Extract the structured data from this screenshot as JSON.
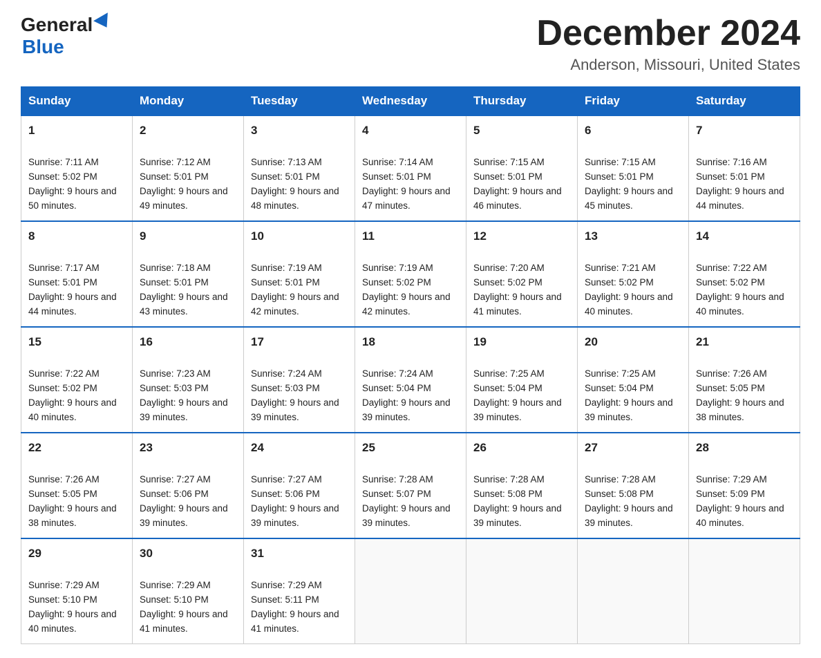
{
  "header": {
    "logo_general": "General",
    "logo_blue": "Blue",
    "month_title": "December 2024",
    "location": "Anderson, Missouri, United States"
  },
  "weekdays": [
    "Sunday",
    "Monday",
    "Tuesday",
    "Wednesday",
    "Thursday",
    "Friday",
    "Saturday"
  ],
  "weeks": [
    [
      {
        "day": "1",
        "sunrise": "Sunrise: 7:11 AM",
        "sunset": "Sunset: 5:02 PM",
        "daylight": "Daylight: 9 hours and 50 minutes."
      },
      {
        "day": "2",
        "sunrise": "Sunrise: 7:12 AM",
        "sunset": "Sunset: 5:01 PM",
        "daylight": "Daylight: 9 hours and 49 minutes."
      },
      {
        "day": "3",
        "sunrise": "Sunrise: 7:13 AM",
        "sunset": "Sunset: 5:01 PM",
        "daylight": "Daylight: 9 hours and 48 minutes."
      },
      {
        "day": "4",
        "sunrise": "Sunrise: 7:14 AM",
        "sunset": "Sunset: 5:01 PM",
        "daylight": "Daylight: 9 hours and 47 minutes."
      },
      {
        "day": "5",
        "sunrise": "Sunrise: 7:15 AM",
        "sunset": "Sunset: 5:01 PM",
        "daylight": "Daylight: 9 hours and 46 minutes."
      },
      {
        "day": "6",
        "sunrise": "Sunrise: 7:15 AM",
        "sunset": "Sunset: 5:01 PM",
        "daylight": "Daylight: 9 hours and 45 minutes."
      },
      {
        "day": "7",
        "sunrise": "Sunrise: 7:16 AM",
        "sunset": "Sunset: 5:01 PM",
        "daylight": "Daylight: 9 hours and 44 minutes."
      }
    ],
    [
      {
        "day": "8",
        "sunrise": "Sunrise: 7:17 AM",
        "sunset": "Sunset: 5:01 PM",
        "daylight": "Daylight: 9 hours and 44 minutes."
      },
      {
        "day": "9",
        "sunrise": "Sunrise: 7:18 AM",
        "sunset": "Sunset: 5:01 PM",
        "daylight": "Daylight: 9 hours and 43 minutes."
      },
      {
        "day": "10",
        "sunrise": "Sunrise: 7:19 AM",
        "sunset": "Sunset: 5:01 PM",
        "daylight": "Daylight: 9 hours and 42 minutes."
      },
      {
        "day": "11",
        "sunrise": "Sunrise: 7:19 AM",
        "sunset": "Sunset: 5:02 PM",
        "daylight": "Daylight: 9 hours and 42 minutes."
      },
      {
        "day": "12",
        "sunrise": "Sunrise: 7:20 AM",
        "sunset": "Sunset: 5:02 PM",
        "daylight": "Daylight: 9 hours and 41 minutes."
      },
      {
        "day": "13",
        "sunrise": "Sunrise: 7:21 AM",
        "sunset": "Sunset: 5:02 PM",
        "daylight": "Daylight: 9 hours and 40 minutes."
      },
      {
        "day": "14",
        "sunrise": "Sunrise: 7:22 AM",
        "sunset": "Sunset: 5:02 PM",
        "daylight": "Daylight: 9 hours and 40 minutes."
      }
    ],
    [
      {
        "day": "15",
        "sunrise": "Sunrise: 7:22 AM",
        "sunset": "Sunset: 5:02 PM",
        "daylight": "Daylight: 9 hours and 40 minutes."
      },
      {
        "day": "16",
        "sunrise": "Sunrise: 7:23 AM",
        "sunset": "Sunset: 5:03 PM",
        "daylight": "Daylight: 9 hours and 39 minutes."
      },
      {
        "day": "17",
        "sunrise": "Sunrise: 7:24 AM",
        "sunset": "Sunset: 5:03 PM",
        "daylight": "Daylight: 9 hours and 39 minutes."
      },
      {
        "day": "18",
        "sunrise": "Sunrise: 7:24 AM",
        "sunset": "Sunset: 5:04 PM",
        "daylight": "Daylight: 9 hours and 39 minutes."
      },
      {
        "day": "19",
        "sunrise": "Sunrise: 7:25 AM",
        "sunset": "Sunset: 5:04 PM",
        "daylight": "Daylight: 9 hours and 39 minutes."
      },
      {
        "day": "20",
        "sunrise": "Sunrise: 7:25 AM",
        "sunset": "Sunset: 5:04 PM",
        "daylight": "Daylight: 9 hours and 39 minutes."
      },
      {
        "day": "21",
        "sunrise": "Sunrise: 7:26 AM",
        "sunset": "Sunset: 5:05 PM",
        "daylight": "Daylight: 9 hours and 38 minutes."
      }
    ],
    [
      {
        "day": "22",
        "sunrise": "Sunrise: 7:26 AM",
        "sunset": "Sunset: 5:05 PM",
        "daylight": "Daylight: 9 hours and 38 minutes."
      },
      {
        "day": "23",
        "sunrise": "Sunrise: 7:27 AM",
        "sunset": "Sunset: 5:06 PM",
        "daylight": "Daylight: 9 hours and 39 minutes."
      },
      {
        "day": "24",
        "sunrise": "Sunrise: 7:27 AM",
        "sunset": "Sunset: 5:06 PM",
        "daylight": "Daylight: 9 hours and 39 minutes."
      },
      {
        "day": "25",
        "sunrise": "Sunrise: 7:28 AM",
        "sunset": "Sunset: 5:07 PM",
        "daylight": "Daylight: 9 hours and 39 minutes."
      },
      {
        "day": "26",
        "sunrise": "Sunrise: 7:28 AM",
        "sunset": "Sunset: 5:08 PM",
        "daylight": "Daylight: 9 hours and 39 minutes."
      },
      {
        "day": "27",
        "sunrise": "Sunrise: 7:28 AM",
        "sunset": "Sunset: 5:08 PM",
        "daylight": "Daylight: 9 hours and 39 minutes."
      },
      {
        "day": "28",
        "sunrise": "Sunrise: 7:29 AM",
        "sunset": "Sunset: 5:09 PM",
        "daylight": "Daylight: 9 hours and 40 minutes."
      }
    ],
    [
      {
        "day": "29",
        "sunrise": "Sunrise: 7:29 AM",
        "sunset": "Sunset: 5:10 PM",
        "daylight": "Daylight: 9 hours and 40 minutes."
      },
      {
        "day": "30",
        "sunrise": "Sunrise: 7:29 AM",
        "sunset": "Sunset: 5:10 PM",
        "daylight": "Daylight: 9 hours and 41 minutes."
      },
      {
        "day": "31",
        "sunrise": "Sunrise: 7:29 AM",
        "sunset": "Sunset: 5:11 PM",
        "daylight": "Daylight: 9 hours and 41 minutes."
      },
      null,
      null,
      null,
      null
    ]
  ]
}
